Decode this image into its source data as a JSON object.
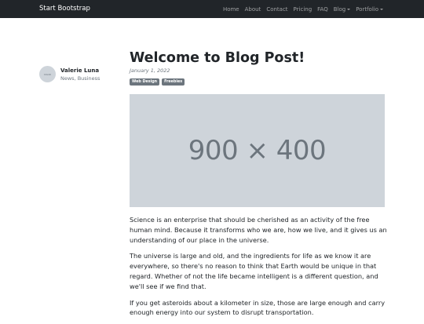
{
  "navbar": {
    "brand": "Start Bootstrap",
    "items": [
      {
        "label": "Home",
        "dropdown": false
      },
      {
        "label": "About",
        "dropdown": false
      },
      {
        "label": "Contact",
        "dropdown": false
      },
      {
        "label": "Pricing",
        "dropdown": false
      },
      {
        "label": "FAQ",
        "dropdown": false
      },
      {
        "label": "Blog",
        "dropdown": true
      },
      {
        "label": "Portfolio",
        "dropdown": true
      }
    ]
  },
  "author": {
    "avatar_text": "40x40",
    "name": "Valerie Luna",
    "categories": "News, Business"
  },
  "post": {
    "title": "Welcome to Blog Post!",
    "date": "January 1, 2022",
    "badges": [
      "Web Design",
      "Freebies"
    ],
    "image_placeholder": "900 × 400",
    "paragraphs": [
      "Science is an enterprise that should be cherished as an activity of the free human mind. Because it transforms who we are, how we live, and it gives us an understanding of our place in the universe.",
      "The universe is large and old, and the ingredients for life as we know it are everywhere, so there's no reason to think that Earth would be unique in that regard. Whether of not the life became intelligent is a different question, and we'll see if we find that.",
      "If you get asteroids about a kilometer in size, those are large enough and carry enough energy into our system to disrupt transportation."
    ]
  },
  "colors": {
    "navbar_bg": "#212529",
    "placeholder_bg": "#ced4da",
    "badge_bg": "#6c757d"
  }
}
